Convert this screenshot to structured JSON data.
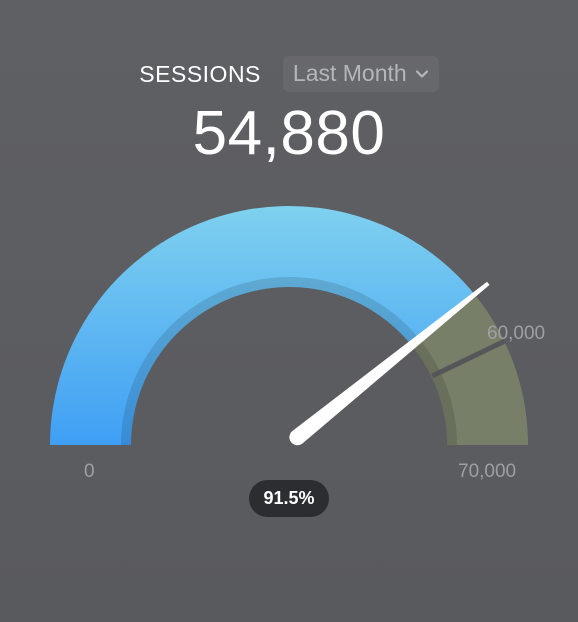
{
  "widget": {
    "metric_label": "SESSIONS",
    "period": "Last Month",
    "value": "54,880",
    "percent_label": "91.5%"
  },
  "gauge": {
    "min": 0,
    "max": 70000,
    "target": 60000,
    "value": 54880,
    "min_label": "0",
    "max_label": "70,000",
    "target_label": "60,000"
  },
  "icons": {
    "period_chevron": "chevron-down-icon"
  },
  "colors": {
    "arc_top": "#7ed0ef",
    "arc_bottom": "#3f9ff4",
    "over_target": "#777f68",
    "needle": "#ffffff",
    "pill": "#2c2d30"
  }
}
